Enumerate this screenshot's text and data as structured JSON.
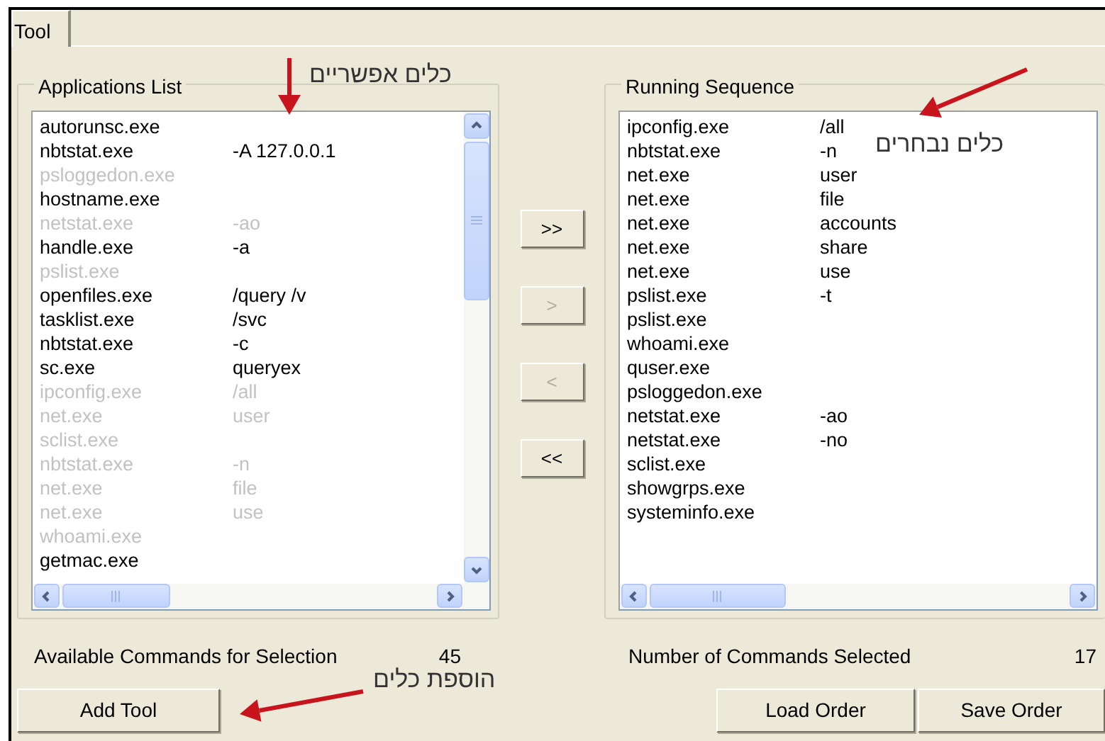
{
  "tabs": [
    {
      "label": "Tool",
      "selected": true
    }
  ],
  "applications_list": {
    "title": "Applications List",
    "rows": [
      {
        "command": "autorunsc.exe",
        "disabled": false
      },
      {
        "command": "nbtstat.exe",
        "args": "-A 127.0.0.1",
        "disabled": false
      },
      {
        "command": "psloggedon.exe",
        "disabled": true
      },
      {
        "command": "hostname.exe",
        "disabled": false
      },
      {
        "command": "netstat.exe",
        "args": "-ao",
        "disabled": true
      },
      {
        "command": "handle.exe",
        "args": "-a",
        "disabled": false
      },
      {
        "command": "pslist.exe",
        "disabled": true
      },
      {
        "command": "openfiles.exe",
        "args": "/query /v",
        "disabled": false
      },
      {
        "command": "tasklist.exe",
        "args": "/svc",
        "disabled": false
      },
      {
        "command": "nbtstat.exe",
        "args": "-c",
        "disabled": false
      },
      {
        "command": "sc.exe",
        "args": "queryex",
        "disabled": false
      },
      {
        "command": "ipconfig.exe",
        "args": "/all",
        "disabled": true
      },
      {
        "command": "net.exe",
        "args": "user",
        "disabled": true
      },
      {
        "command": "sclist.exe",
        "disabled": true
      },
      {
        "command": "nbtstat.exe",
        "args": "-n",
        "disabled": true
      },
      {
        "command": "net.exe",
        "args": "file",
        "disabled": true
      },
      {
        "command": "net.exe",
        "args": "use",
        "disabled": true
      },
      {
        "command": "whoami.exe",
        "disabled": true
      },
      {
        "command": "getmac.exe",
        "disabled": false
      }
    ]
  },
  "move_buttons": [
    {
      "label": ">>",
      "disabled": false
    },
    {
      "label": ">",
      "disabled": true
    },
    {
      "label": "<",
      "disabled": true
    },
    {
      "label": "<<",
      "disabled": false
    }
  ],
  "running_sequence": {
    "title": "Running Sequence",
    "rows": [
      {
        "command": "ipconfig.exe",
        "args": "/all"
      },
      {
        "command": "nbtstat.exe",
        "args": "-n"
      },
      {
        "command": "net.exe",
        "args": "user"
      },
      {
        "command": "net.exe",
        "args": "file"
      },
      {
        "command": "net.exe",
        "args": "accounts"
      },
      {
        "command": "net.exe",
        "args": "share"
      },
      {
        "command": "net.exe",
        "args": "use"
      },
      {
        "command": "pslist.exe",
        "args": "-t"
      },
      {
        "command": "pslist.exe"
      },
      {
        "command": "whoami.exe"
      },
      {
        "command": "quser.exe"
      },
      {
        "command": "psloggedon.exe"
      },
      {
        "command": "netstat.exe",
        "args": "-ao"
      },
      {
        "command": "netstat.exe",
        "args": "-no"
      },
      {
        "command": "sclist.exe"
      },
      {
        "command": "showgrps.exe"
      },
      {
        "command": "systeminfo.exe"
      }
    ]
  },
  "available_label": "Available Commands for Selection",
  "available_count": "45",
  "selected_label": "Number of Commands Selected",
  "selected_count": "17",
  "add_button": "Add Tool",
  "order_buttons": [
    "Load Order",
    "Save Order"
  ],
  "annotations": [
    {
      "text": "כלים אפשריים"
    },
    {
      "text": "כלים נבחרים"
    },
    {
      "text": "הוספת כלים"
    }
  ]
}
